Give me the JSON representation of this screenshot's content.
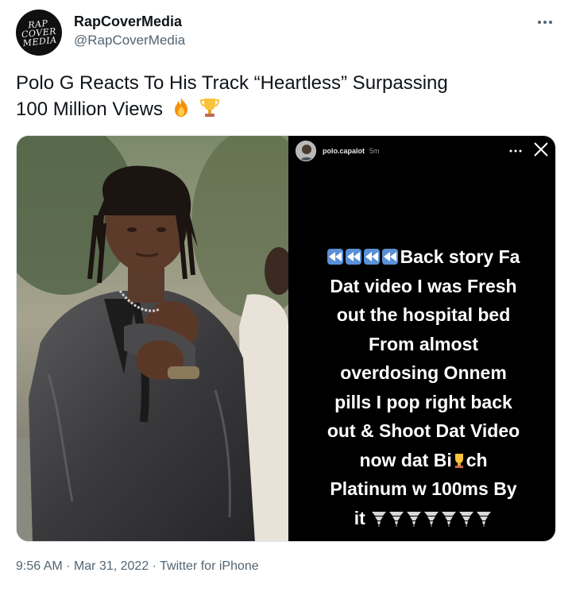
{
  "author": {
    "display_name": "RapCoverMedia",
    "handle": "@RapCoverMedia",
    "avatar_logo_lines": [
      "RAP",
      "COVER",
      "MEDIA"
    ]
  },
  "more_icon": "more-horizontal-icon",
  "tweet": {
    "text_line1": "Polo G Reacts To His Track “Heartless” Surpassing",
    "text_line2": "100 Million Views",
    "emojis": [
      "fire-emoji",
      "trophy-emoji"
    ]
  },
  "story": {
    "username": "polo.capalot",
    "time": "5m",
    "lines": [
      "Back story Fa",
      "Dat video I was Fresh",
      "out the hospital bed",
      "From almost",
      "overdosing Onnem",
      "pills I pop right back",
      "out & Shoot Dat Video",
      "now dat Bi",
      "ch",
      "Platinum w 100ms By",
      "it"
    ],
    "rewind_emoji_count": 4,
    "trophy_emoji_count": 7
  },
  "meta": {
    "time": "9:56 AM",
    "date": "Mar 31, 2022",
    "source": "Twitter for iPhone",
    "separator": "·"
  },
  "colors": {
    "text_primary": "#0f1419",
    "text_secondary": "#536471",
    "story_bg": "#000000",
    "rewind_blue": "#5b8fd6"
  }
}
